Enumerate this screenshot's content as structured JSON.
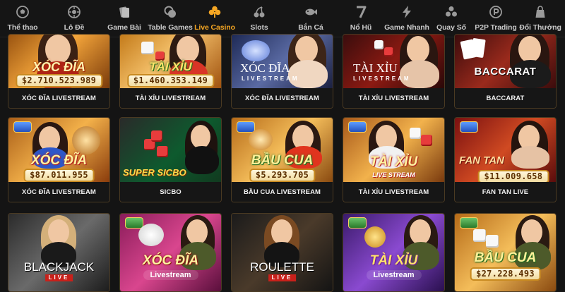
{
  "nav": {
    "items": [
      {
        "label": "Thể thao",
        "icon": "soccer-ball-icon"
      },
      {
        "label": "Lô Đề",
        "icon": "lottery-ball-icon"
      },
      {
        "label": "Game Bài",
        "icon": "cards-icon"
      },
      {
        "label": "Table Games",
        "icon": "chips-icon"
      },
      {
        "label": "Live Casino",
        "icon": "clover-icon",
        "active": true
      },
      {
        "label": "Slots",
        "icon": "cherry-icon"
      },
      {
        "label": "Bắn Cá",
        "icon": "fish-icon"
      },
      {
        "label": "Nổ Hũ",
        "icon": "seven-icon"
      },
      {
        "label": "Game Nhanh",
        "icon": "lightning-icon"
      },
      {
        "label": "Quay Số",
        "icon": "balls-icon"
      },
      {
        "label": "P2P Trading",
        "icon": "p2p-icon"
      },
      {
        "label": "Đổi Thưởng",
        "icon": "gift-bag-icon"
      }
    ],
    "active_color": "#f5a623"
  },
  "games": [
    {
      "title": "XÓC ĐĨA LIVESTREAM",
      "art_text": "XÓC ĐĨA",
      "jackpot": "$2.710.523.989"
    },
    {
      "title": "TÀI XỈU LIVESTREAM",
      "art_text": "TÀI XỈU",
      "jackpot": "$1.460.353.149"
    },
    {
      "title": "XÓC ĐĨA LIVESTREAM",
      "art_text": "XÓC ĐĨA",
      "art_sub": "LIVESTREAM"
    },
    {
      "title": "TÀI XỈU LIVESTREAM",
      "art_text": "TÀI XỈU",
      "art_sub": "LIVESTREAM"
    },
    {
      "title": "BACCARAT",
      "art_text": "BACCARAT"
    },
    {
      "title": "XÓC ĐĨA LIVESTREAM",
      "art_text": "XÓC ĐĨA",
      "jackpot": "$87.011.955"
    },
    {
      "title": "SICBO",
      "art_text": "SUPER SICBO"
    },
    {
      "title": "BẦU CUA LIVESTREAM",
      "art_text": "BẦU CUA",
      "jackpot": "$5.293.705"
    },
    {
      "title": "TÀI XỈU LIVESTREAM",
      "art_text": "TÀI XỈU",
      "art_sub": "LIVE STREAM"
    },
    {
      "title": "FAN TAN LIVE",
      "art_text": "FAN TAN",
      "jackpot": "$11.009.658"
    },
    {
      "art_text": "BLACKJACK",
      "art_sub": "LIVE"
    },
    {
      "art_text": "XÓC ĐĨA",
      "art_sub": "Livestream"
    },
    {
      "art_text": "ROULETTE",
      "art_sub": "LIVE"
    },
    {
      "art_text": "TÀI XỈU",
      "art_sub": "Livestream"
    },
    {
      "art_text": "BẦU CUA",
      "jackpot": "$27.228.493"
    }
  ]
}
